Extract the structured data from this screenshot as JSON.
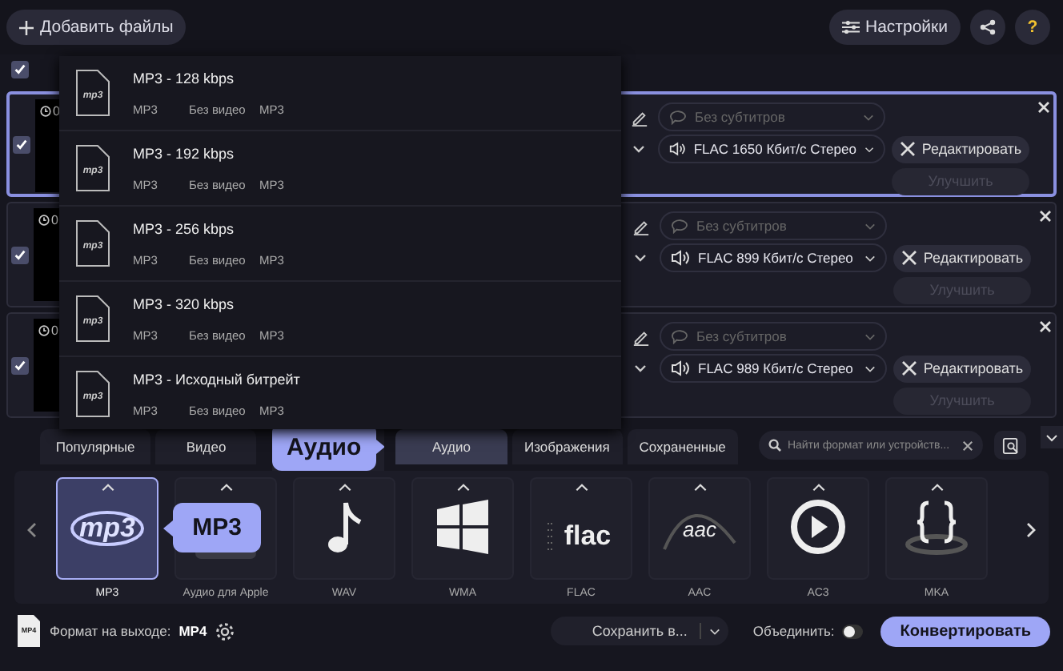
{
  "toolbar": {
    "add_button": "Добавить файлы",
    "settings_button": "Настройки",
    "help_button": "?"
  },
  "select_all": {
    "checked": true
  },
  "files": [
    {
      "checked": true,
      "selected": true,
      "time": "0",
      "subtitles": "Без субтитров",
      "audio": "FLAC 1650 Кбит/с Стерео",
      "edit_button": "Редактировать",
      "enhance_button": "Улучшить"
    },
    {
      "checked": true,
      "selected": false,
      "time": "0",
      "subtitles": "Без субтитров",
      "audio": "FLAC 899 Кбит/с Стерео",
      "edit_button": "Редактировать",
      "enhance_button": "Улучшить"
    },
    {
      "checked": true,
      "selected": false,
      "time": "0",
      "subtitles": "Без субтитров",
      "audio": "FLAC 989 Кбит/с Стерео",
      "edit_button": "Редактировать",
      "enhance_button": "Улучшить"
    }
  ],
  "preset_menu": {
    "items": [
      {
        "title": "MP3 - 128 kbps",
        "icon_text": "mp3",
        "details": [
          "MP3",
          "Без видео",
          "MP3"
        ]
      },
      {
        "title": "MP3 - 192 kbps",
        "icon_text": "mp3",
        "details": [
          "MP3",
          "Без видео",
          "MP3"
        ]
      },
      {
        "title": "MP3 - 256 kbps",
        "icon_text": "mp3",
        "details": [
          "MP3",
          "Без видео",
          "MP3"
        ]
      },
      {
        "title": "MP3 - 320 kbps",
        "icon_text": "mp3",
        "details": [
          "MP3",
          "Без видео",
          "MP3"
        ]
      },
      {
        "title": "MP3 - Исходный битрейт",
        "icon_text": "mp3",
        "details": [
          "MP3",
          "Без видео",
          "MP3"
        ]
      }
    ]
  },
  "format_tabs": [
    {
      "label": "Популярные",
      "selected": false
    },
    {
      "label": "Видео",
      "selected": false
    },
    {
      "label": "Аудио",
      "selected": true
    },
    {
      "label": "Изображения",
      "selected": false
    },
    {
      "label": "Сохраненные",
      "selected": false
    }
  ],
  "search": {
    "placeholder": "Найти формат или устройств..."
  },
  "tooltips": [
    {
      "kind": "tab",
      "text": "Аудио"
    },
    {
      "kind": "format",
      "text": "MP3"
    }
  ],
  "formats": [
    {
      "kind": "mp3",
      "label": "MP3",
      "logo": "mp3",
      "selected": true
    },
    {
      "kind": "apple",
      "label": "Аудио для Apple",
      "selected": false
    },
    {
      "kind": "note",
      "label": "WAV",
      "selected": false
    },
    {
      "kind": "windows",
      "label": "WMA",
      "selected": false
    },
    {
      "kind": "flac",
      "label": "FLAC",
      "logo": "flac",
      "selected": false
    },
    {
      "kind": "aac",
      "label": "AAC",
      "logo": "aac",
      "selected": false
    },
    {
      "kind": "play",
      "label": "AC3",
      "selected": false
    },
    {
      "kind": "braces",
      "label": "MKA",
      "selected": false
    }
  ],
  "bottom": {
    "output_icon_text": "MP4",
    "output_label": "Формат на выходе:",
    "output_value": "MP4",
    "save_button": "Сохранить в...",
    "merge_label": "Объединить:",
    "merge_on": false,
    "convert_button": "Конвертировать"
  }
}
